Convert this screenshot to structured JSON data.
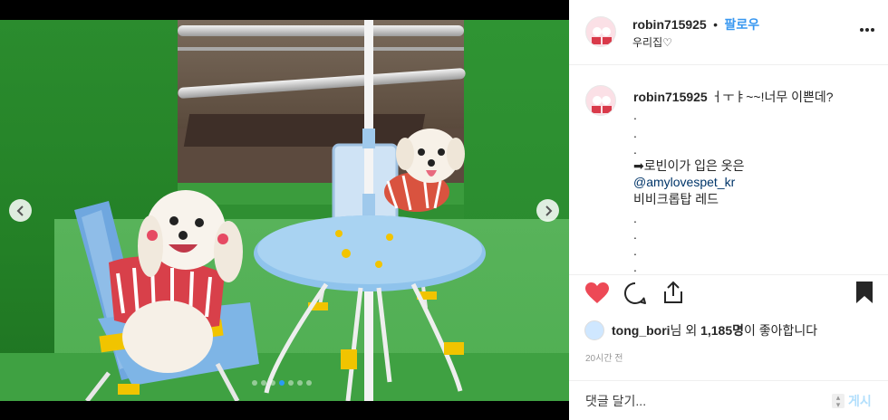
{
  "post": {
    "username": "robin715925",
    "separator": "•",
    "follow_label": "팔로우",
    "location": "우리집♡",
    "caption": {
      "username": "robin715925",
      "lines": [
        "ㅓㅜㅑ~~!너무 이쁜데?",
        ".",
        ".",
        ".",
        "➡로빈이가 입은 옷은",
        "@amylovespet_kr",
        "비비크롭탑 레드",
        ".",
        ".",
        ".",
        "."
      ]
    },
    "likes": {
      "liker": "tong_bori",
      "text_mid": "님 외 ",
      "count": "1,185명",
      "text_end": "이 좋아합니다"
    },
    "time": "20시간 전",
    "comment_placeholder": "댓글 달기...",
    "post_label": "게시"
  },
  "carousel": {
    "total": 7,
    "active_index": 3
  },
  "icons": {
    "like": "heart-icon",
    "comment": "comment-icon",
    "share": "share-icon",
    "save": "bookmark-icon",
    "more": "more-options-icon",
    "prev": "chevron-left-icon",
    "next": "chevron-right-icon"
  },
  "colors": {
    "like": "#ed4956",
    "follow": "#3897f0",
    "active_dot": "#2a9bf5",
    "post_disabled": "#b2dffc"
  }
}
